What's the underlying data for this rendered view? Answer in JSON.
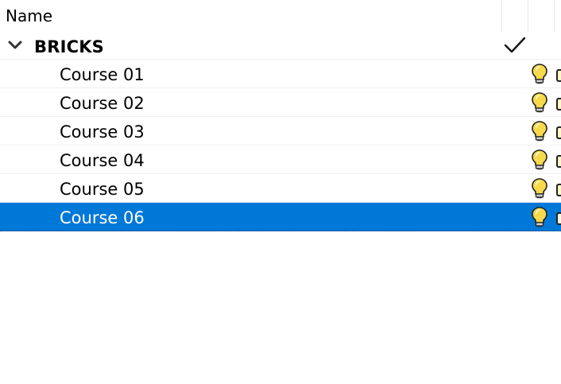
{
  "header": {
    "name_label": "Name"
  },
  "group": {
    "label": "BRICKS",
    "expanded": true,
    "checked": true
  },
  "rows": [
    {
      "label": "Course 01",
      "selected": false,
      "icon": "lightbulb-icon"
    },
    {
      "label": "Course 02",
      "selected": false,
      "icon": "lightbulb-icon"
    },
    {
      "label": "Course 03",
      "selected": false,
      "icon": "lightbulb-icon"
    },
    {
      "label": "Course 04",
      "selected": false,
      "icon": "lightbulb-icon"
    },
    {
      "label": "Course 05",
      "selected": false,
      "icon": "lightbulb-icon"
    },
    {
      "label": "Course 06",
      "selected": true,
      "icon": "lightbulb-icon"
    }
  ],
  "colors": {
    "selection": "#0078d7",
    "bulb_fill": "#f7d94c",
    "row_divider": "#f0f0f0"
  }
}
